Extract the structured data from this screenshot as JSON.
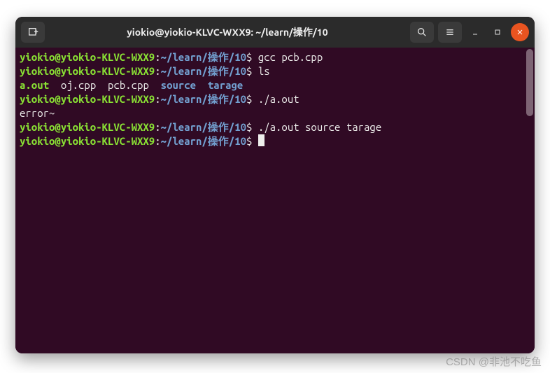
{
  "titlebar": {
    "title": "yiokio@yiokio-KLVC-WXX9: ~/learn/操作/10"
  },
  "prompt": {
    "user_host": "yiokio@yiokio-KLVC-WXX9",
    "colon": ":",
    "path": "~/learn/操作/10",
    "dollar": "$"
  },
  "lines": {
    "cmd1": " gcc pcb.cpp",
    "cmd2": " ls",
    "ls_out": {
      "exec": "a.out",
      "gap1": "  ",
      "f1": "oj.cpp",
      "gap2": "  ",
      "f2": "pcb.cpp",
      "gap3": "  ",
      "d1": "source",
      "gap4": "  ",
      "d2": "tarage"
    },
    "cmd3": " ./a.out",
    "err": "error~",
    "cmd4": " ./a.out source tarage",
    "cmd5": " "
  },
  "watermark": "CSDN @非池不吃鱼"
}
